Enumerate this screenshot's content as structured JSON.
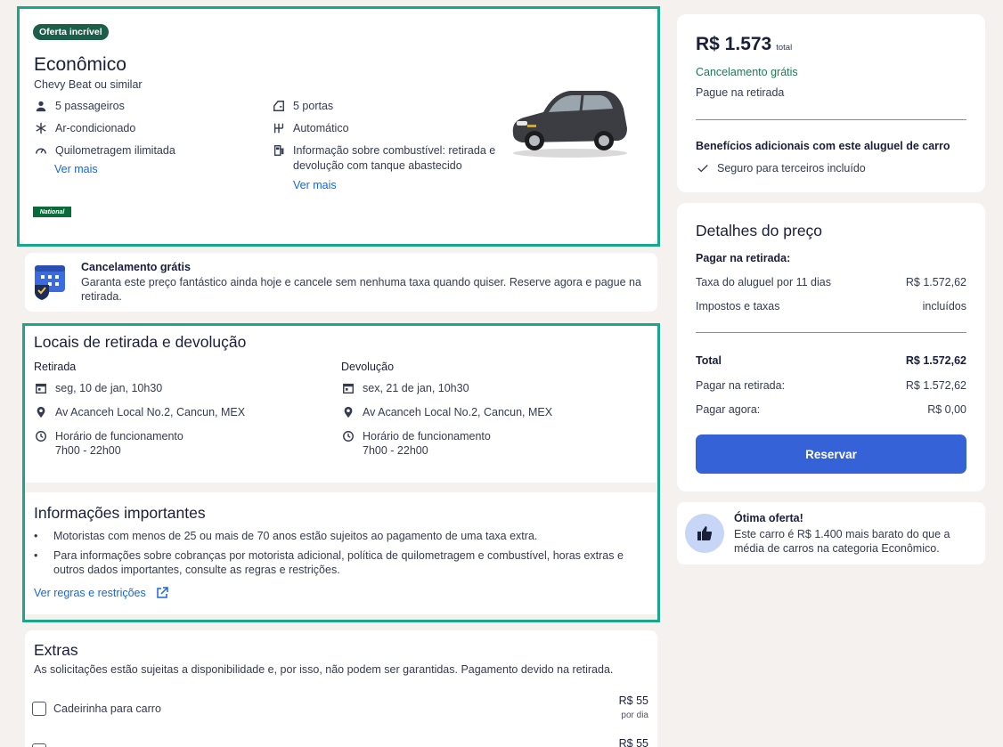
{
  "car": {
    "badge": "Oferta incrível",
    "title": "Econômico",
    "subtitle": "Chevy Beat ou similar",
    "features_left": [
      {
        "icon": "person-icon",
        "text": "5 passageiros"
      },
      {
        "icon": "snowflake-icon",
        "text": "Ar-condicionado"
      },
      {
        "icon": "speedometer-icon",
        "text": "Quilometragem ilimitada"
      }
    ],
    "see_more_left": "Ver mais",
    "features_right": [
      {
        "icon": "car-door-icon",
        "text": "5 portas"
      },
      {
        "icon": "gear-shift-icon",
        "text": "Automático"
      },
      {
        "icon": "fuel-pump-icon",
        "text": "Informação sobre combustível: retirada e devolução com tanque abastecido"
      }
    ],
    "see_more_right": "Ver mais",
    "vendor_logo": "National",
    "car_color": "#3b3d42"
  },
  "cancel_banner": {
    "title": "Cancelamento grátis",
    "text": "Garanta este preço fantástico ainda hoje e cancele sem nenhuma taxa quando quiser. Reserve agora e pague na retirada."
  },
  "locations": {
    "heading": "Locais de retirada e devolução",
    "pickup": {
      "label": "Retirada",
      "date": "seg, 10 de jan, 10h30",
      "address": "Av Acanceh Local No.2, Cancun, MEX",
      "hours_label": "Horário de funcionamento",
      "hours": "7h00 - 22h00"
    },
    "dropoff": {
      "label": "Devolução",
      "date": "sex, 21 de jan, 10h30",
      "address": "Av Acanceh Local No.2, Cancun, MEX",
      "hours_label": "Horário de funcionamento",
      "hours": "7h00 - 22h00"
    }
  },
  "important": {
    "heading": "Informações importantes",
    "bullets": [
      "Motoristas com menos de 25 ou mais de 70 anos estão sujeitos ao pagamento de uma taxa extra.",
      "Para informações sobre cobranças por motorista adicional, política de quilometragem e combustível, horas extras e outros dados importantes, consulte as regras e restrições."
    ],
    "link": "Ver regras e restrições"
  },
  "extras": {
    "heading": "Extras",
    "note": "As solicitações estão sujeitas a disponibilidade e, por isso, não podem ser garantidas. Pagamento devido na retirada.",
    "items": [
      {
        "label": "Cadeirinha para carro",
        "price": "R$ 55",
        "unit": "por dia"
      },
      {
        "label": "",
        "price": "R$ 55",
        "unit": ""
      }
    ]
  },
  "summary": {
    "price": "R$ 1.573",
    "price_suffix": "total",
    "cancel": "Cancelamento grátis",
    "pay_at": "Pague na retirada",
    "benefits_title": "Benefícios adicionais com este aluguel de carro",
    "benefit": "Seguro para terceiros incluído"
  },
  "price_details": {
    "heading": "Detalhes do preço",
    "subheading": "Pagar na retirada:",
    "rows": [
      {
        "label": "Taxa do aluguel por 11 dias",
        "value": "R$ 1.572,62"
      },
      {
        "label": "Impostos e taxas",
        "value": "incluídos"
      }
    ],
    "total_label": "Total",
    "total_value": "R$ 1.572,62",
    "pay_pickup_label": "Pagar na retirada:",
    "pay_pickup_value": "R$ 1.572,62",
    "pay_now_label": "Pagar agora:",
    "pay_now_value": "R$ 0,00",
    "button": "Reservar",
    "button_color": "#3662d8"
  },
  "deal": {
    "title": "Ótima oferta!",
    "text": "Este carro é R$ 1.400 mais barato do que a média de carros na categoria Econômico."
  },
  "colors": {
    "highlight": "#1aa68a",
    "badge_bg": "#1d5e4a",
    "link": "#1668e3",
    "green_text": "#227950"
  }
}
